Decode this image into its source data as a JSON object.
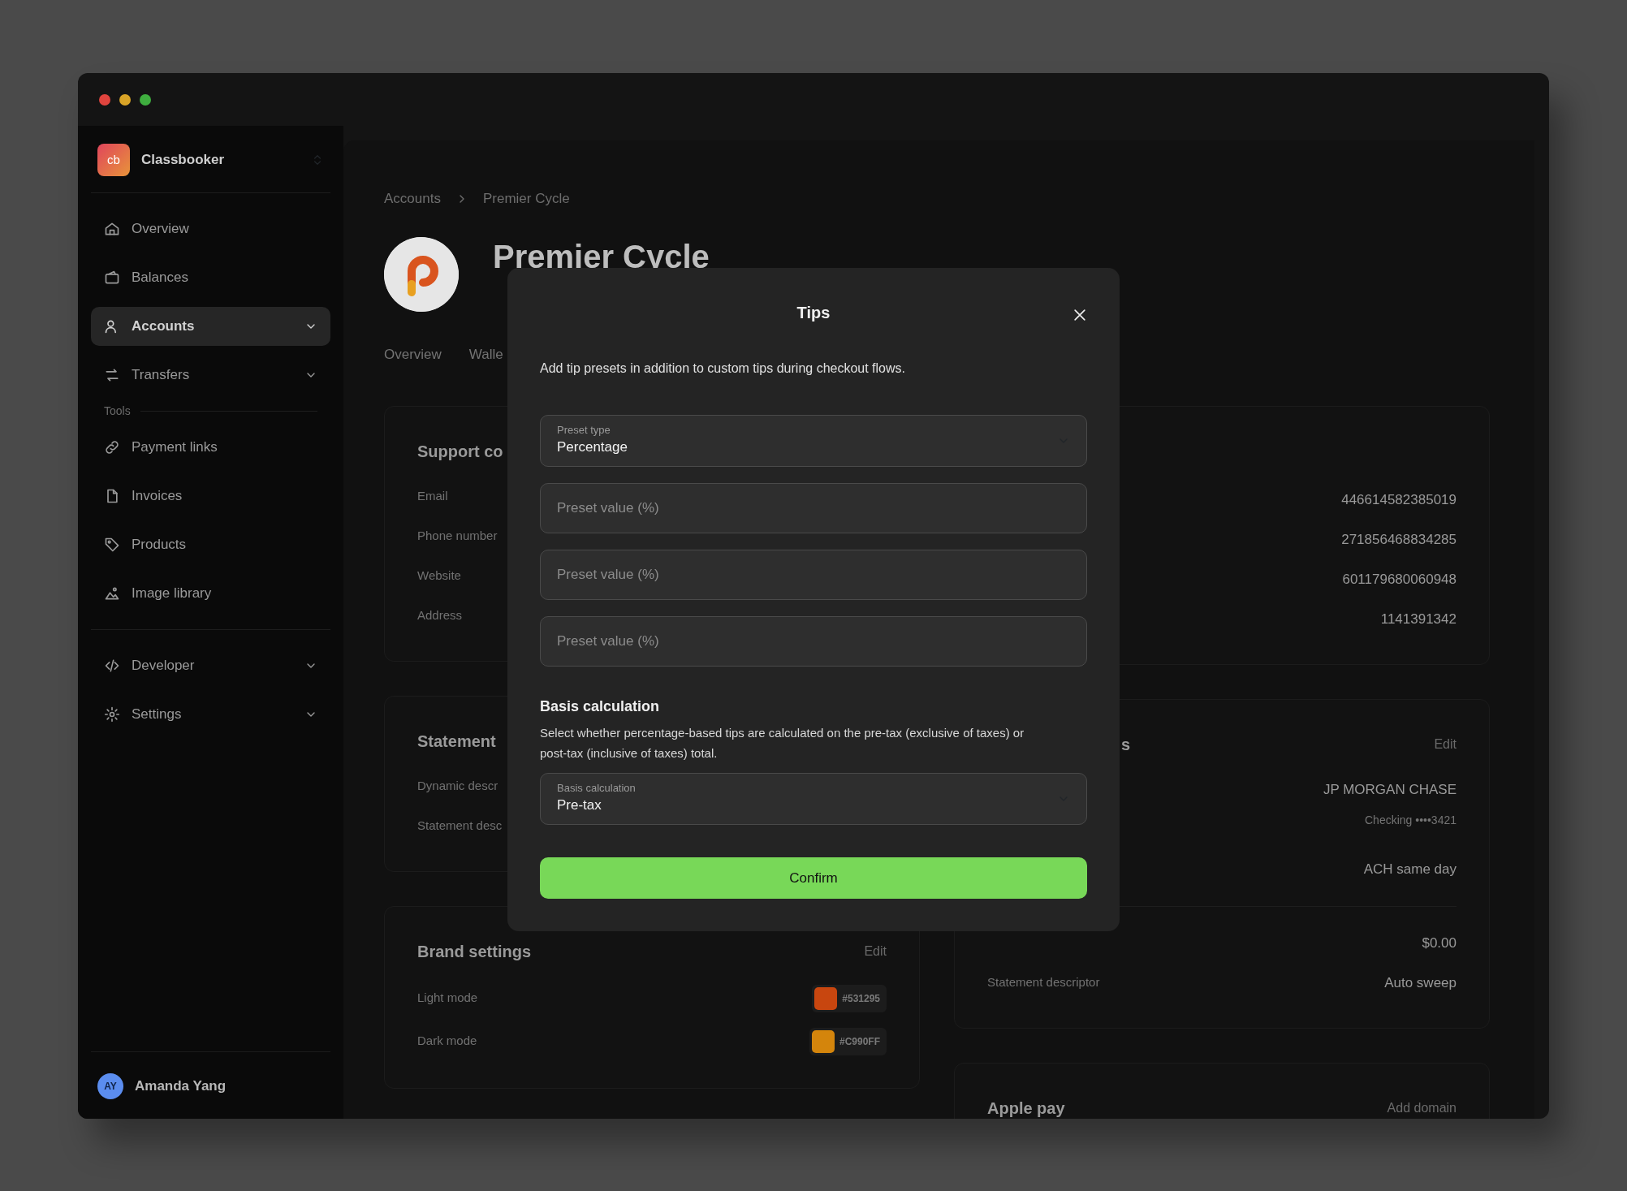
{
  "sidebar": {
    "workspace": "Classbooker",
    "workspace_logo": "cb",
    "nav_groups": [
      {
        "items": [
          {
            "label": "Overview",
            "selected": false,
            "expandable": false
          },
          {
            "label": "Balances",
            "selected": false,
            "expandable": false
          },
          {
            "label": "Accounts",
            "selected": true,
            "expandable": true
          },
          {
            "label": "Transfers",
            "selected": false,
            "expandable": true
          }
        ]
      },
      {
        "title": "Tools",
        "items": [
          {
            "label": "Payment links",
            "selected": false,
            "expandable": false
          },
          {
            "label": "Invoices",
            "selected": false,
            "expandable": false
          },
          {
            "label": "Products",
            "selected": false,
            "expandable": false
          },
          {
            "label": "Image library",
            "selected": false,
            "expandable": false
          }
        ]
      },
      {
        "items": [
          {
            "label": "Developer",
            "selected": false,
            "expandable": true
          },
          {
            "label": "Settings",
            "selected": false,
            "expandable": true
          }
        ]
      }
    ],
    "user": {
      "initials": "AY",
      "name": "Amanda Yang"
    }
  },
  "main": {
    "breadcrumb": [
      "Accounts",
      "Premier Cycle"
    ],
    "title": "Premier Cycle",
    "tabs": [
      {
        "label": "Overview",
        "selected": false
      },
      {
        "label": "Walle",
        "selected": false
      }
    ],
    "left_cards": [
      {
        "title": "Support co",
        "rows": [
          {
            "label": "Email"
          },
          {
            "label": "Phone number"
          },
          {
            "label": "Website"
          },
          {
            "label": "Address"
          }
        ]
      },
      {
        "title": "Statement",
        "rows": [
          {
            "label": "Dynamic descr"
          },
          {
            "label": "Statement desc"
          }
        ]
      },
      {
        "title": "Brand settings",
        "action": "Edit",
        "rows": [
          {
            "label": "Light mode",
            "color": "#c8460f",
            "value": "#531295"
          },
          {
            "label": "Dark mode",
            "color": "#d4850c",
            "value": "#C990FF"
          }
        ]
      }
    ],
    "right_cards": [
      {
        "sections": [
          [
            {
              "value": "446614582385019"
            },
            {
              "value": "271856468834285"
            },
            {
              "value": "601179680060948"
            },
            {
              "value": "1141391342"
            }
          ]
        ]
      },
      {
        "title": "s",
        "action": "Edit",
        "sections": [
          [
            {
              "value": "JP MORGAN CHASE"
            },
            {
              "value": "Checking ••••3421",
              "kind": "sub"
            },
            {
              "value": "ACH same day"
            }
          ],
          [
            {
              "value": "$0.00"
            },
            {
              "label": "Statement descriptor",
              "value": "Auto sweep"
            }
          ]
        ]
      },
      {
        "title": "Apple pay",
        "action": "Add domain"
      }
    ]
  },
  "dialog": {
    "title": "Tips",
    "description": "Add tip presets in addition to custom tips during checkout flows.",
    "preset_type": {
      "label": "Preset type",
      "value": "Percentage"
    },
    "preset_values": [
      {
        "placeholder": "Preset value (%)"
      },
      {
        "placeholder": "Preset value (%)"
      },
      {
        "placeholder": "Preset value (%)"
      }
    ],
    "basis_heading": "Basis calculation",
    "basis_description": "Select whether percentage-based tips are calculated on the pre-tax (exclusive of taxes) or post-tax (inclusive of taxes) total.",
    "basis_select": {
      "label": "Basis calculation",
      "value": "Pre-tax"
    },
    "confirm": "Confirm"
  }
}
